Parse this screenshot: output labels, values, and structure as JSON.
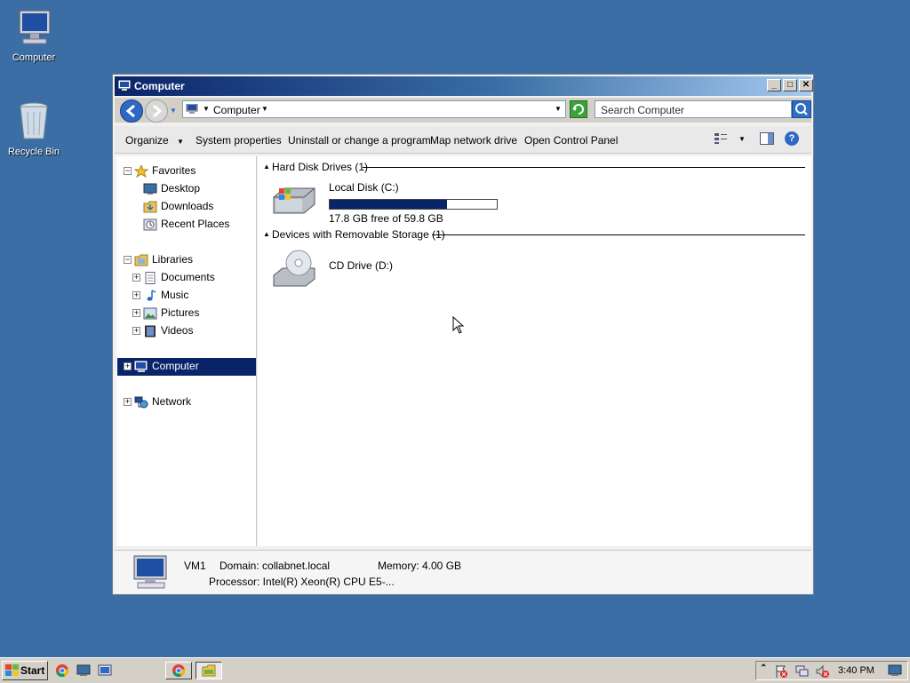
{
  "desktop": {
    "icons": [
      {
        "label": "Computer"
      },
      {
        "label": "Recycle Bin"
      }
    ]
  },
  "window": {
    "title": "Computer",
    "address": {
      "breadcrumb": "Computer"
    },
    "search": {
      "placeholder": "Search Computer"
    },
    "toolbar": {
      "organize": "Organize",
      "system_properties": "System properties",
      "uninstall": "Uninstall or change a program",
      "map_drive": "Map network drive",
      "control_panel": "Open Control Panel"
    },
    "nav": {
      "favorites": "Favorites",
      "desktop": "Desktop",
      "downloads": "Downloads",
      "recent_places": "Recent Places",
      "libraries": "Libraries",
      "documents": "Documents",
      "music": "Music",
      "pictures": "Pictures",
      "videos": "Videos",
      "computer": "Computer",
      "network": "Network"
    },
    "content": {
      "hard_disk_group": "Hard Disk Drives (1)",
      "local_disk": {
        "name": "Local Disk (C:)",
        "free": "17.8 GB free of 59.8 GB",
        "used_fraction": 0.702
      },
      "removable_group": "Devices with Removable Storage (1)",
      "cd_drive": {
        "name": "CD Drive (D:)"
      }
    },
    "details": {
      "name": "VM1",
      "domain": "Domain: collabnet.local",
      "memory": "Memory: 4.00 GB",
      "processor": "Processor: Intel(R) Xeon(R) CPU E5-..."
    }
  },
  "taskbar": {
    "start": "Start",
    "clock": "3:40 PM"
  },
  "colors": {
    "desktop": "#3a6ea5",
    "selection": "#0a246a",
    "capacity_bar": "#0a246a"
  }
}
